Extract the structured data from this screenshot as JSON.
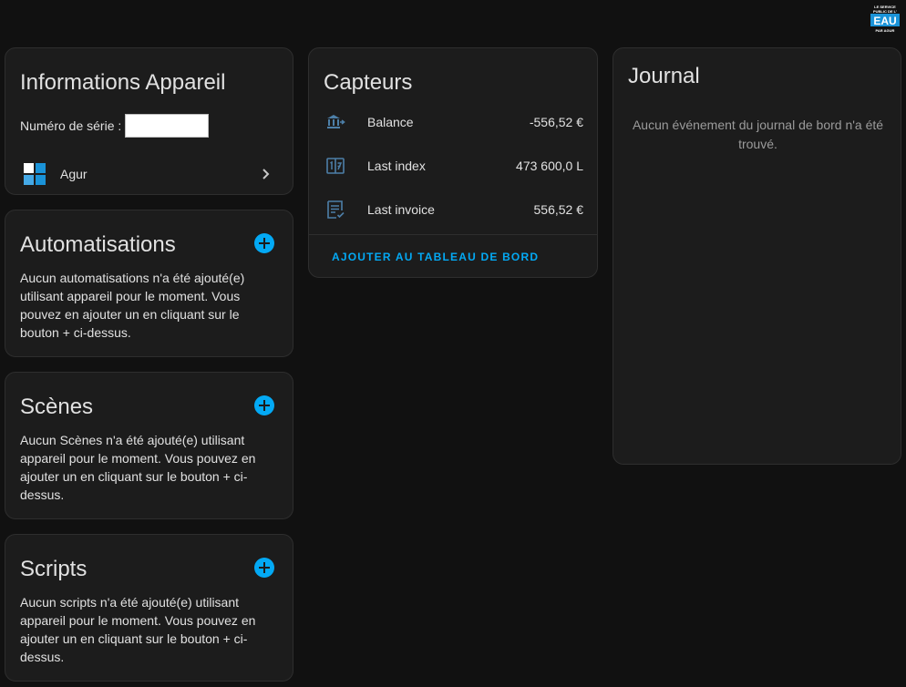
{
  "brand_logo": {
    "lines": [
      "LE SERVICE",
      "PUBLIC DE L'",
      "EAU",
      "PAR AGUR"
    ]
  },
  "device_info": {
    "title": "Informations Appareil",
    "serial_label": "Numéro de série :",
    "serial_value": "",
    "manufacturer": "Agur",
    "manufacturer_logo_colors": [
      "#ffffff",
      "#1a93d8",
      "#45a9e6",
      "#1a93d8"
    ]
  },
  "automations": {
    "title": "Automatisations",
    "description": "Aucun automatisations n'a été ajouté(e) utilisant appareil pour le moment. Vous pouvez en ajouter un en cliquant sur le bouton + ci-dessus."
  },
  "scenes": {
    "title": "Scènes",
    "description": "Aucun Scènes n'a été ajouté(e) utilisant appareil pour le moment. Vous pouvez en ajouter un en cliquant sur le bouton + ci-dessus."
  },
  "scripts": {
    "title": "Scripts",
    "description": "Aucun scripts n'a été ajouté(e) utilisant appareil pour le moment. Vous pouvez en ajouter un en cliquant sur le bouton + ci-dessus."
  },
  "sensors": {
    "title": "Capteurs",
    "items": [
      {
        "name": "Balance",
        "value": "-556,52 €",
        "icon": "bank-transfer-icon"
      },
      {
        "name": "Last index",
        "value": "473 600,0 L",
        "icon": "counter-icon"
      },
      {
        "name": "Last invoice",
        "value": "556,52 €",
        "icon": "invoice-check-icon"
      }
    ],
    "add_to_dashboard": "AJOUTER AU TABLEAU DE BORD"
  },
  "journal": {
    "title": "Journal",
    "empty_message": "Aucun événement du journal de bord n'a été trouvé."
  },
  "colors": {
    "accent": "#03a9f4",
    "icon": "#4d7fa8",
    "background": "#111111",
    "card": "#1c1c1c"
  }
}
